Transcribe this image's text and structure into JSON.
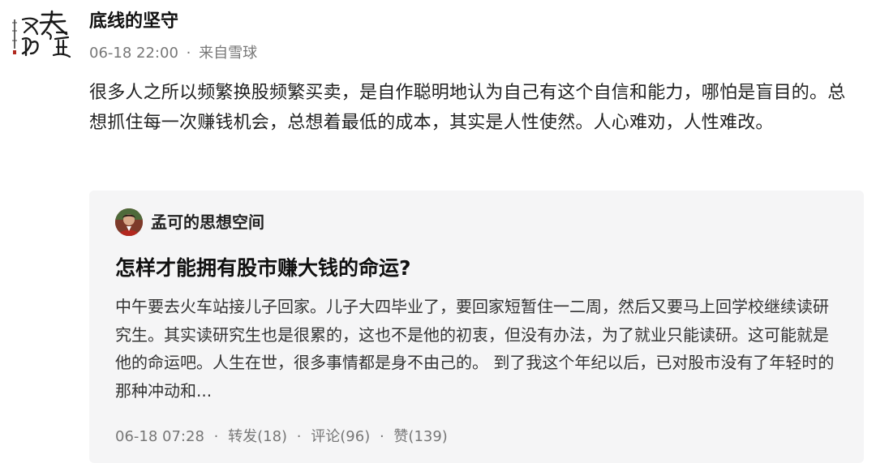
{
  "post": {
    "author": "底线的坚守",
    "timestamp": "06-18 22:00",
    "separator": "·",
    "source": "来自雪球",
    "text": "很多人之所以频繁换股频繁买卖，是自作聪明地认为自己有这个自信和能力，哪怕是盲目的。总想抓住每一次赚钱机会，总想着最低的成本，其实是人性使然。人心难劝，人性难改。",
    "avatar_icon": "calligraphy-seal-icon"
  },
  "quoted": {
    "author": "孟可的思想空间",
    "avatar_icon": "user-photo-avatar",
    "title": "怎样才能拥有股市赚大钱的命运?",
    "excerpt": "中午要去火车站接儿子回家。儿子大四毕业了，要回家短暂住一二周，然后又要马上回学校继续读研究生。其实读研究生也是很累的，这也不是他的初衷，但没有办法，为了就业只能读研。这可能就是他的命运吧。人生在世，很多事情都是身不由己的。 到了我这个年纪以后，已对股市没有了年轻时的那种冲动和...",
    "timestamp": "06-18 07:28",
    "separator": "·",
    "repost": "转发(18)",
    "comment": "评论(96)",
    "like": "赞(139)"
  },
  "colors": {
    "text_primary": "#222222",
    "text_meta": "#777777",
    "card_background": "#f5f5f6"
  }
}
